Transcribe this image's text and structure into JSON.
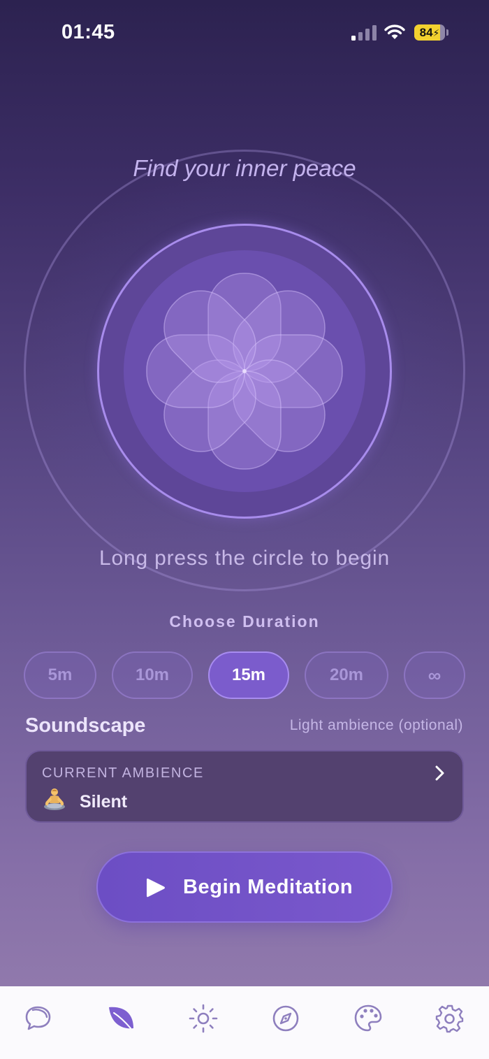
{
  "status_bar": {
    "time": "01:45",
    "battery": "84",
    "battery_level": 0.84
  },
  "main": {
    "tagline": "Find your inner peace",
    "hint": "Long press the circle to begin"
  },
  "duration": {
    "title": "Choose Duration",
    "options": [
      "5m",
      "10m",
      "15m",
      "20m",
      "∞"
    ],
    "selected": "15m"
  },
  "soundscape": {
    "title": "Soundscape",
    "subtitle": "Light ambience (optional)",
    "current_label": "CURRENT AMBIENCE",
    "current_icon": "meditating-person-icon",
    "current_value": "Silent"
  },
  "begin_button": {
    "label": "Begin Meditation",
    "icon": "play-icon"
  },
  "tabbar": {
    "tabs": [
      {
        "name": "chat",
        "icon": "chat-bubbles-icon",
        "active": false
      },
      {
        "name": "meditate",
        "icon": "leaf-icon",
        "active": true
      },
      {
        "name": "daily",
        "icon": "sun-icon",
        "active": false
      },
      {
        "name": "explore",
        "icon": "compass-icon",
        "active": false
      },
      {
        "name": "theme",
        "icon": "palette-icon",
        "active": false
      },
      {
        "name": "settings",
        "icon": "gear-icon",
        "active": false
      }
    ],
    "colors": {
      "active": "#7d5fd0",
      "inactive": "#8e7fbe"
    }
  }
}
